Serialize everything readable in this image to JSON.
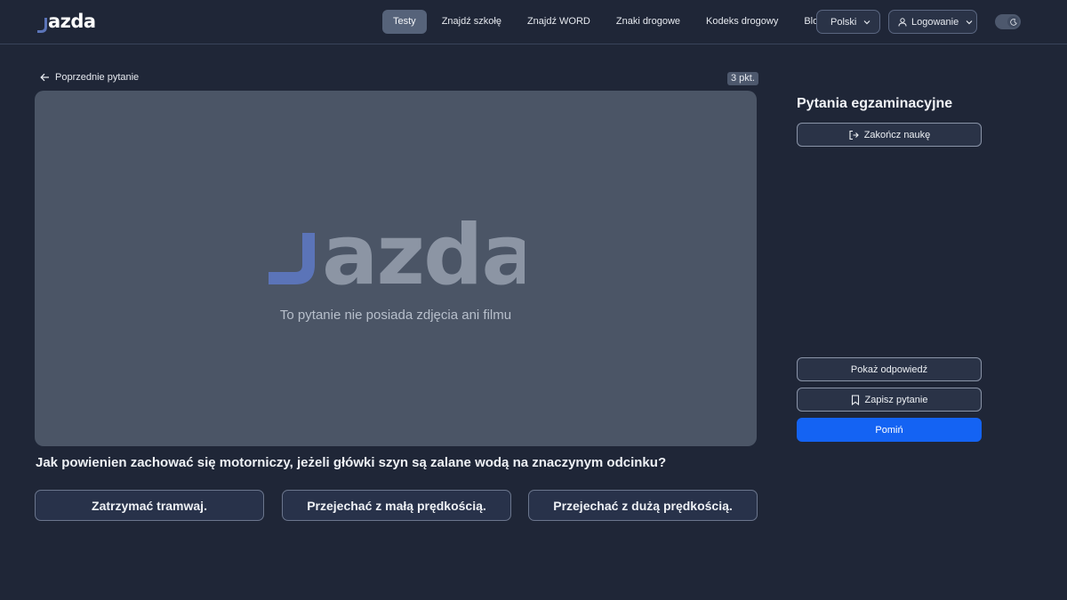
{
  "header": {
    "logo": "jazda",
    "nav": [
      {
        "label": "Testy",
        "active": true
      },
      {
        "label": "Znajdź szkołę",
        "active": false
      },
      {
        "label": "Znajdź WORD",
        "active": false
      },
      {
        "label": "Znaki drogowe",
        "active": false
      },
      {
        "label": "Kodeks drogowy",
        "active": false
      },
      {
        "label": "Blog",
        "active": false
      }
    ],
    "language_label": "Polski",
    "login_label": "Logowanie",
    "theme_toggle": "dark-mode"
  },
  "main": {
    "back_label": "Poprzednie pytanie",
    "points_label": "3 pkt.",
    "media_logo": "jazda",
    "media_caption": "To pytanie nie posiada zdjęcia ani filmu",
    "question": "Jak powienien zachować się motorniczy, jeżeli główki szyn są zalane wodą na znaczynym odcinku?",
    "answers": [
      "Zatrzymać tramwaj.",
      "Przejechać z małą prędkością.",
      "Przejechać z dużą prędkością."
    ]
  },
  "sidebar": {
    "title": "Pytania egzaminacyjne",
    "end_label": "Zakończ naukę",
    "show_answer_label": "Pokaż odpowiedź",
    "save_label": "Zapisz pytanie",
    "skip_label": "Pomiń"
  },
  "colors": {
    "background": "#1f2637",
    "accent": "#1463f3",
    "logo_accent": "#5b74b8"
  }
}
